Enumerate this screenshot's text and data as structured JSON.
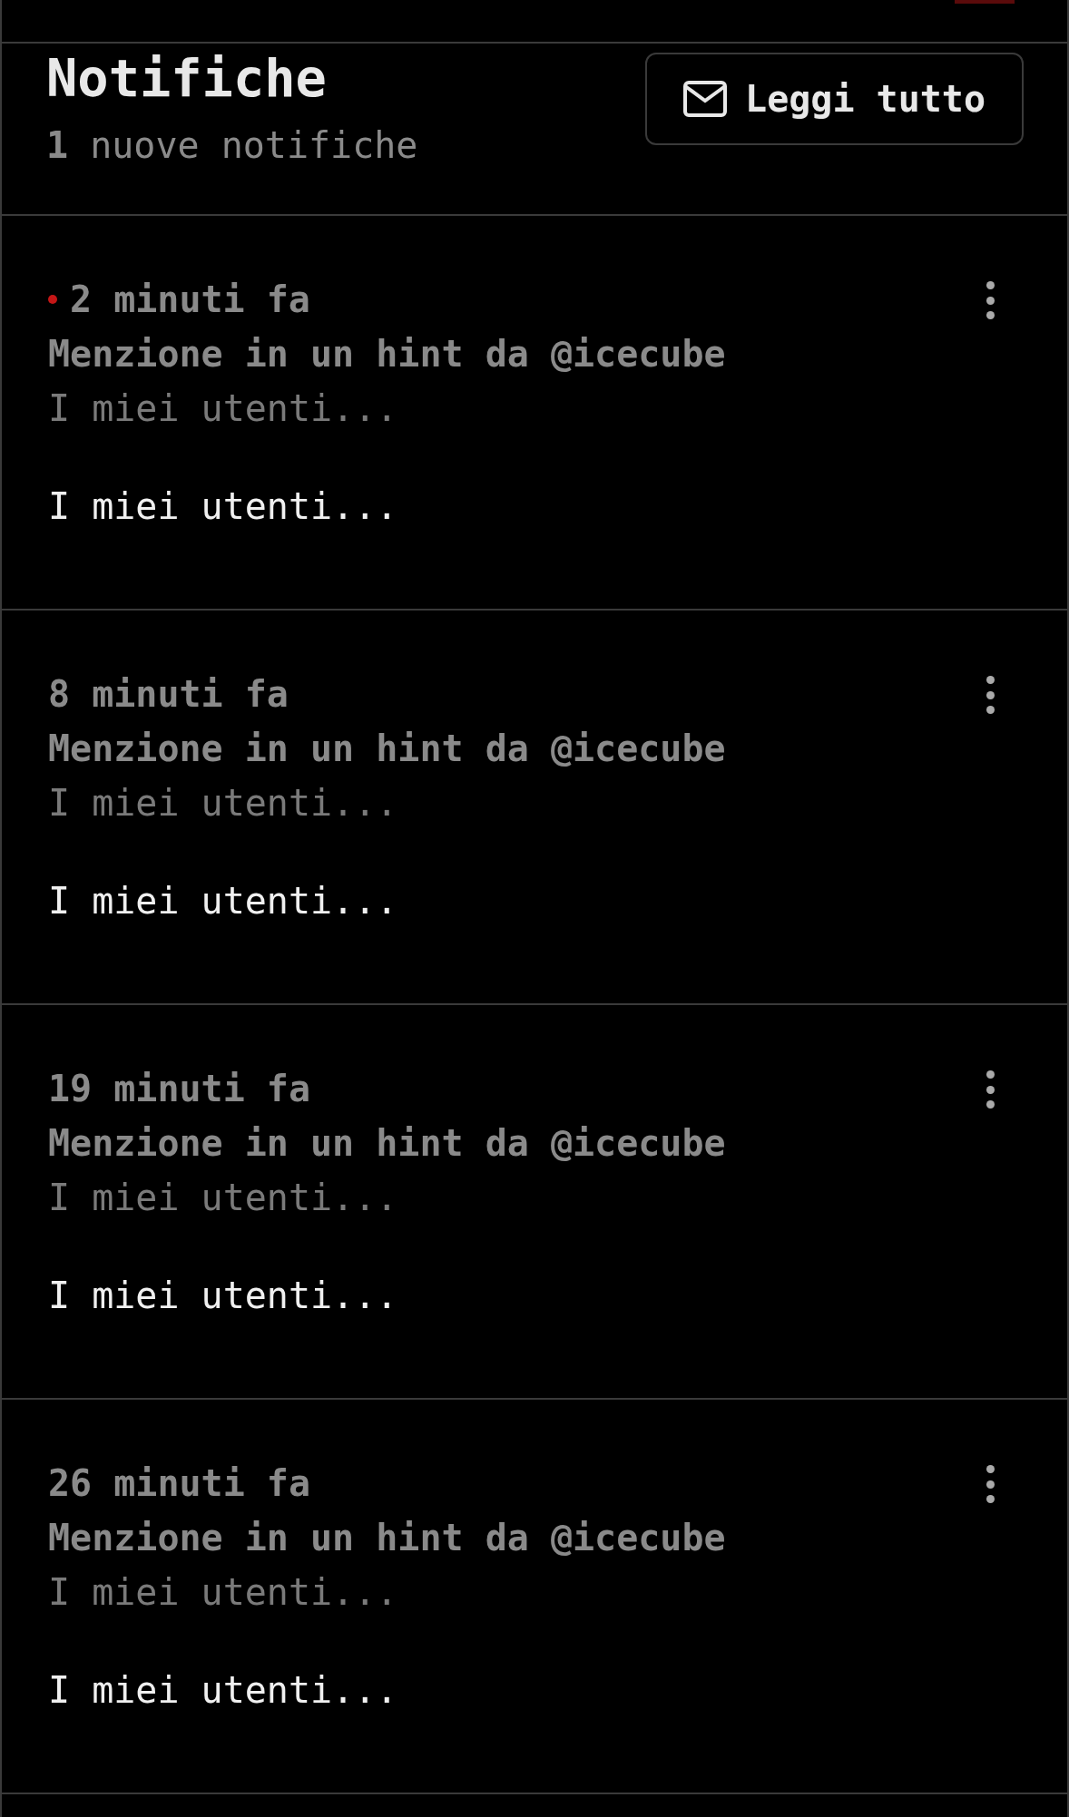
{
  "header": {
    "title": "Notifiche",
    "subtitle": "**1** nuove notifiche",
    "button": {
      "label": "Leggi tutto"
    }
  },
  "notifications": [
    {
      "unread": true,
      "time": "2 minuti fa",
      "title": "Menzione in un hint da @icecube",
      "excerpt": "I miei utenti...",
      "body": "I miei utenti..."
    },
    {
      "unread": false,
      "time": "8 minuti fa",
      "title": "Menzione in un hint da @icecube",
      "excerpt": "I miei utenti...",
      "body": "I miei utenti..."
    },
    {
      "unread": false,
      "time": "19 minuti fa",
      "title": "Menzione in un hint da @icecube",
      "excerpt": "I miei utenti...",
      "body": "I miei utenti..."
    },
    {
      "unread": false,
      "time": "26 minuti fa",
      "title": "Menzione in un hint da @icecube",
      "excerpt": "I miei utenti...",
      "body": "I miei utenti..."
    }
  ]
}
